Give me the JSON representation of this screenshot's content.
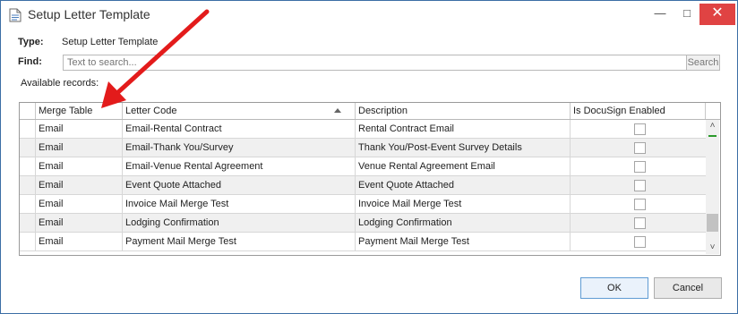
{
  "window": {
    "title": "Setup Letter Template",
    "minimize_glyph": "—",
    "maximize_glyph": "□",
    "close_glyph": "✕"
  },
  "form": {
    "type_label": "Type:",
    "type_value": "Setup Letter Template",
    "find_label": "Find:",
    "search_placeholder": "Text to search...",
    "search_button": "Search",
    "available_label": "Available records:"
  },
  "grid": {
    "columns": [
      "Merge Table",
      "Letter Code",
      "Description",
      "Is DocuSign Enabled"
    ],
    "sorted_column": "Letter Code",
    "rows": [
      {
        "merge_table": "Email",
        "letter_code": "Email-Rental Contract",
        "description": "Rental Contract Email",
        "docusign": false
      },
      {
        "merge_table": "Email",
        "letter_code": "Email-Thank You/Survey",
        "description": "Thank You/Post-Event Survey Details",
        "docusign": false
      },
      {
        "merge_table": "Email",
        "letter_code": "Email-Venue Rental Agreement",
        "description": "Venue Rental Agreement Email",
        "docusign": false
      },
      {
        "merge_table": "Email",
        "letter_code": "Event Quote Attached",
        "description": "Event Quote Attached",
        "docusign": false
      },
      {
        "merge_table": "Email",
        "letter_code": "Invoice Mail Merge Test",
        "description": "Invoice Mail Merge Test",
        "docusign": false
      },
      {
        "merge_table": "Email",
        "letter_code": "Lodging Confirmation",
        "description": "Lodging Confirmation",
        "docusign": false
      },
      {
        "merge_table": "Email",
        "letter_code": "Payment Mail Merge Test",
        "description": "Payment Mail Merge Test",
        "docusign": false
      }
    ]
  },
  "buttons": {
    "ok": "OK",
    "cancel": "Cancel"
  },
  "colors": {
    "annotation_arrow": "#e31b1b",
    "close_button": "#e04343",
    "ok_border": "#5f9bd3"
  }
}
